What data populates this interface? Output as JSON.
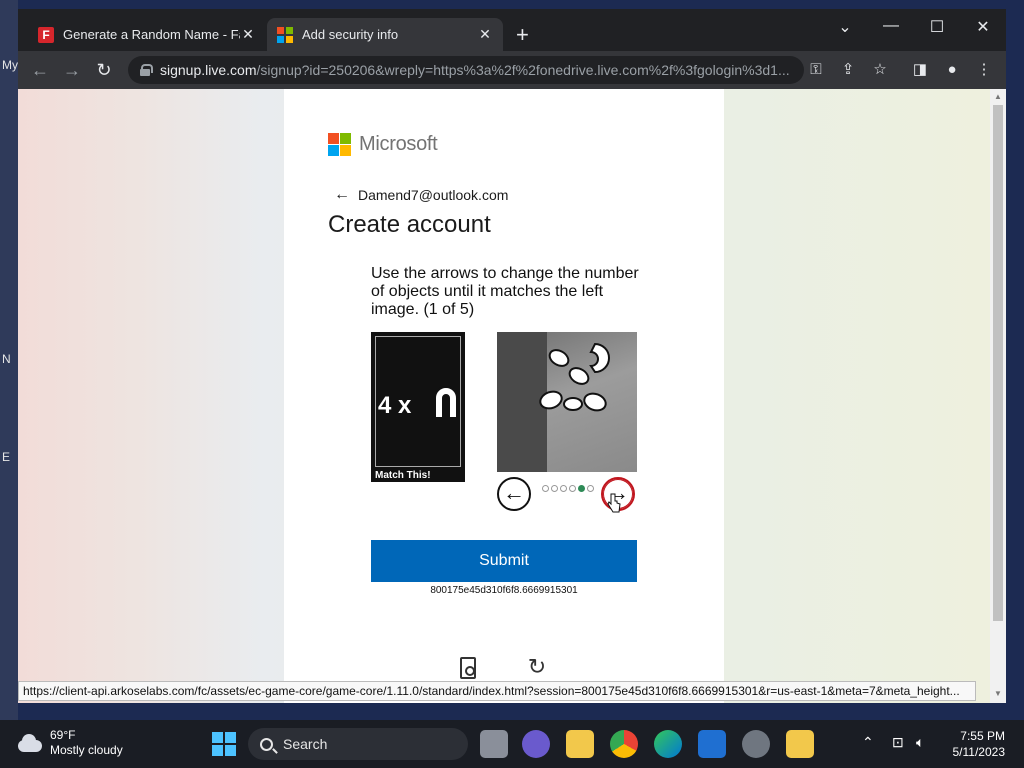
{
  "desktop": {
    "labels": [
      "My",
      "N",
      "E"
    ]
  },
  "browser": {
    "tabs": [
      {
        "title": "Generate a Random Name - Fake",
        "favicon": "fakename-f-icon",
        "active": false
      },
      {
        "title": "Add security info",
        "favicon": "microsoft-icon",
        "active": true
      }
    ],
    "new_tab_label": "+",
    "url": {
      "host": "signup.live.com",
      "path": "/signup?id=250206&wreply=https%3a%2f%2fonedrive.live.com%2f%3fgologin%3d1..."
    },
    "status_url": "https://client-api.arkoselabs.com/fc/assets/ec-game-core/game-core/1.11.0/standard/index.html?session=800175e45d310f6f8.6669915301&r=us-east-1&meta=7&meta_height..."
  },
  "page": {
    "logo_text": "Microsoft",
    "email": "Damend7@outlook.com",
    "heading": "Create account",
    "captcha": {
      "instructions": "Use the arrows to change the number of objects until it matches the left image. (1 of 5)",
      "match_count": "4 x",
      "match_caption": "Match This!",
      "dots_total": 6,
      "active_dot_index": 4,
      "submit_label": "Submit",
      "session_code": "800175e45d310f6f8.6669915301"
    }
  },
  "taskbar": {
    "weather_temp": "69°F",
    "weather_desc": "Mostly cloudy",
    "search_label": "Search",
    "time": "7:55 PM",
    "date": "5/11/2023"
  },
  "colors": {
    "accent": "#0067b8",
    "ms_red": "#f25022",
    "ms_green": "#7fba00",
    "ms_blue": "#00a4ef",
    "ms_yellow": "#ffb900",
    "nav_active": "#c0161e"
  }
}
